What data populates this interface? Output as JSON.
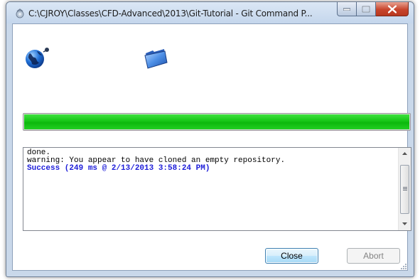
{
  "window": {
    "title": "C:\\CJROY\\Classes\\CFD-Advanced\\2013\\Git-Tutorial - Git Command P..."
  },
  "icons": {
    "title": "tortoisegit-icon",
    "left": "globe-remote-icon",
    "right": "folder-icon"
  },
  "progress": {
    "value_percent": 100,
    "color": "#16c516"
  },
  "log": {
    "lines": [
      "done.",
      "warning: You appear to have cloned an empty repository.",
      "Success (249 ms @ 2/13/2013 3:58:24 PM)"
    ],
    "success_color": "#1c1cd9"
  },
  "buttons": {
    "close": "Close",
    "abort": "Abort"
  }
}
